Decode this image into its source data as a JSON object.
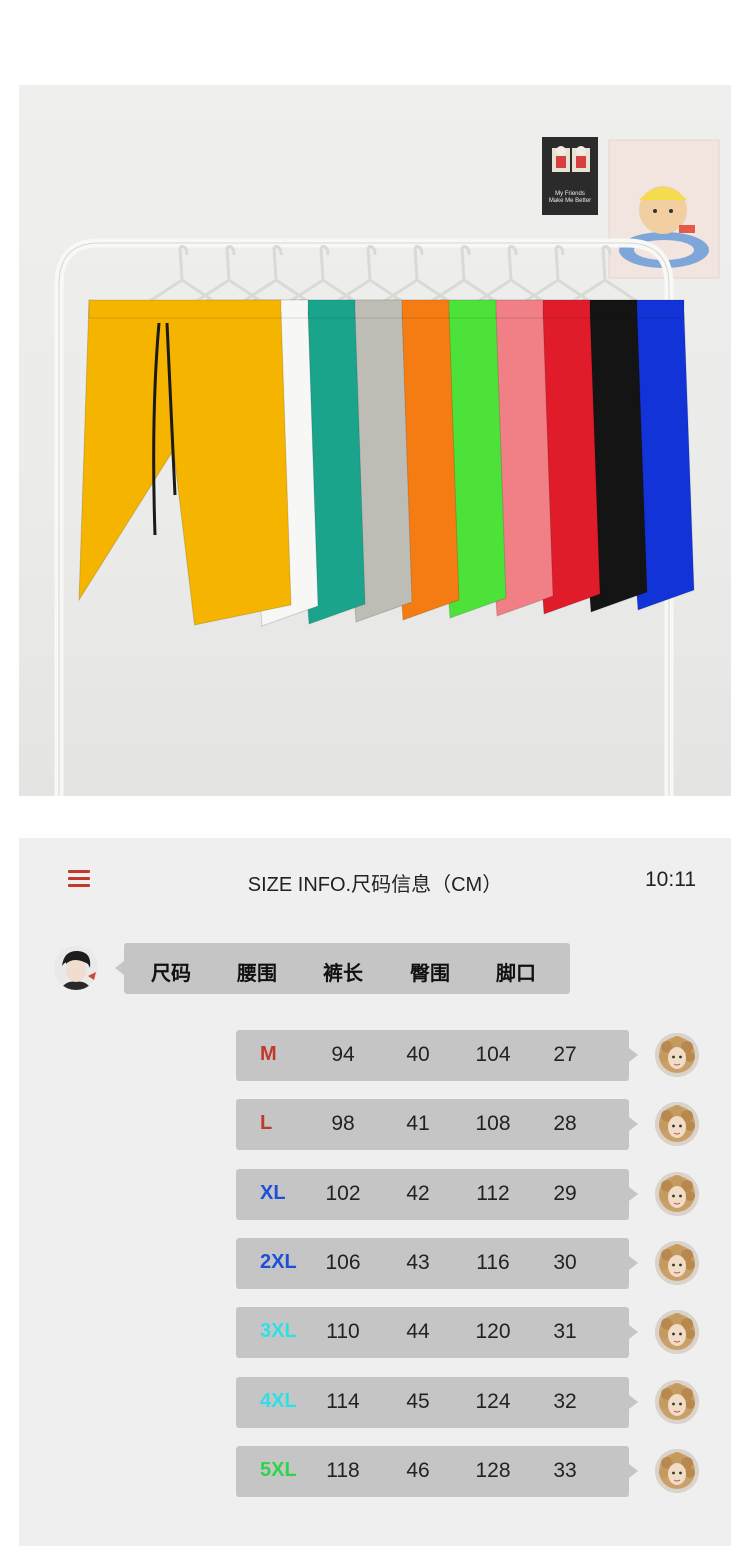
{
  "header": {
    "title": "SIZE INFO.尺码信息（CM）",
    "time": "10:11"
  },
  "columns": [
    "尺码",
    "腰围",
    "裤长",
    "臀围",
    "脚口"
  ],
  "rows": [
    {
      "size": "M",
      "color": "#c0392b",
      "waist": "94",
      "length": "40",
      "hip": "104",
      "hem": "27"
    },
    {
      "size": "L",
      "color": "#c0392b",
      "waist": "98",
      "length": "41",
      "hip": "108",
      "hem": "28"
    },
    {
      "size": "XL",
      "color": "#1f4fd6",
      "waist": "102",
      "length": "42",
      "hip": "112",
      "hem": "29"
    },
    {
      "size": "2XL",
      "color": "#1f4fd6",
      "waist": "106",
      "length": "43",
      "hip": "116",
      "hem": "30"
    },
    {
      "size": "3XL",
      "color": "#2ee0e6",
      "waist": "110",
      "length": "44",
      "hip": "120",
      "hem": "31"
    },
    {
      "size": "4XL",
      "color": "#2ee0e6",
      "waist": "114",
      "length": "45",
      "hip": "124",
      "hem": "32"
    },
    {
      "size": "5XL",
      "color": "#2fd44a",
      "waist": "118",
      "length": "46",
      "hip": "128",
      "hem": "33"
    }
  ],
  "poster": {
    "line1": "My Friends",
    "line2": "Make Me Better"
  },
  "shorts_colors": [
    "#f4b400",
    "#f7f7f5",
    "#1aa48c",
    "#bdbdb6",
    "#f57c12",
    "#4de23a",
    "#f07f86",
    "#e01b2a",
    "#141414",
    "#1233d8"
  ],
  "icons": {
    "menu": "menu-icon",
    "avatar_user": "boy-avatar",
    "avatar_reply": "curly-hair-avatar"
  }
}
